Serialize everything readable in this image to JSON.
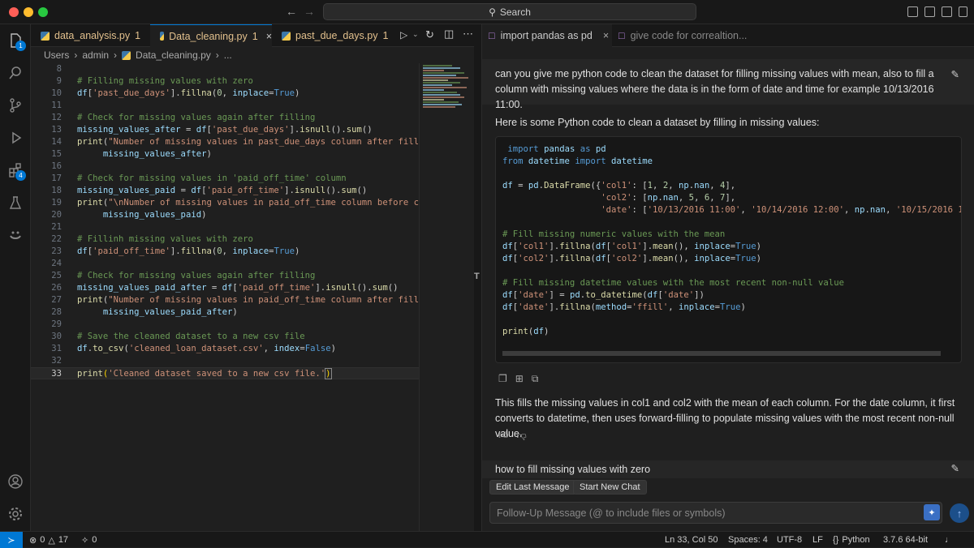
{
  "titlebar": {
    "search_label": "Search"
  },
  "activity": {
    "explorer_badge": "1",
    "extensions_badge": "4"
  },
  "editor_tabs": [
    {
      "label": "data_analysis.py",
      "count": "1"
    },
    {
      "label": "Data_cleaning.py",
      "count": "1"
    },
    {
      "label": "past_due_days.py",
      "count": "1"
    }
  ],
  "breadcrumb": {
    "part1": "Users",
    "part2": "admin",
    "part3": "Data_cleaning.py",
    "more": "..."
  },
  "chat": {
    "tabs": [
      {
        "label": "import pandas as pd"
      },
      {
        "label": "give code for correaltion..."
      }
    ],
    "user_message": "can you give me python code to clean the dataset for filling missing values with mean, also to fill a column with missing values where the data is in the form of date and time for example 10/13/2016 11:00.",
    "assistant_intro": "Here is some Python code to clean a dataset by filling in missing values:",
    "assistant_outro": "This fills the missing values in col1 and col2 with the mean of each column. For the date column, it first converts to datetime, then uses forward-filling to populate missing values with the most recent non-null value.",
    "user_message2": "how to fill missing values with zero",
    "edit_last_label": "Edit Last Message",
    "new_chat_label": "Start New Chat",
    "followup_placeholder": "Follow-Up Message (@ to include files or symbols)"
  },
  "status": {
    "errors": "0",
    "warnings": "17",
    "ports": "0",
    "position": "Ln 33, Col 50",
    "spaces": "Spaces: 4",
    "encoding": "UTF-8",
    "eol": "LF",
    "language": "Python",
    "interpreter": "3.7.6 64-bit"
  }
}
